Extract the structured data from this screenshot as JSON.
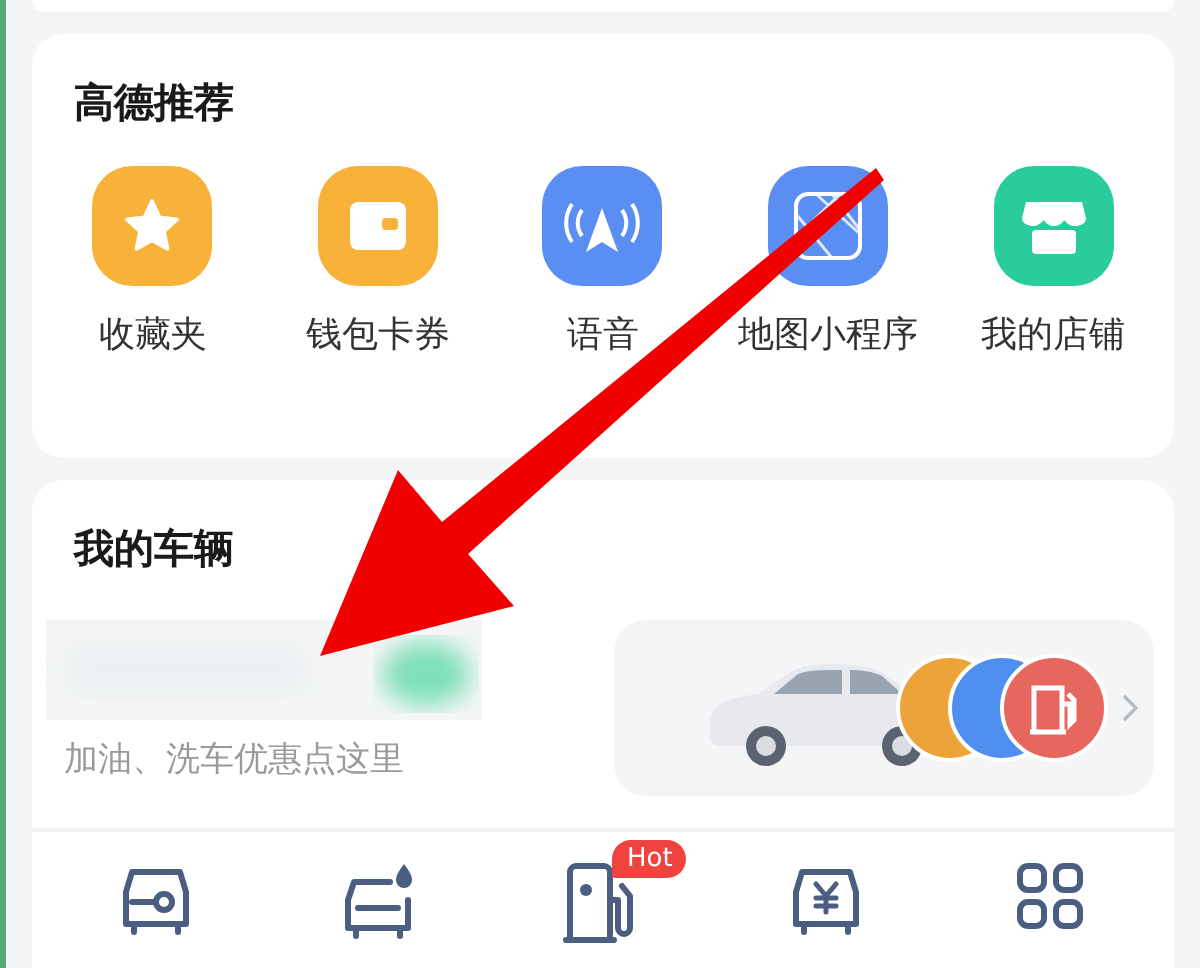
{
  "recommend": {
    "title": "高德推荐",
    "items": [
      {
        "kind": "star",
        "label": "收藏夹"
      },
      {
        "kind": "wallet",
        "label": "钱包卡券"
      },
      {
        "kind": "voice",
        "label": "语音"
      },
      {
        "kind": "map",
        "label": "地图小程序"
      },
      {
        "kind": "shop",
        "label": "我的店铺"
      }
    ]
  },
  "vehicle": {
    "title": "我的车辆",
    "subtitle": "加油、洗车优惠点这里"
  },
  "shortcuts": [
    {
      "kind": "car-key"
    },
    {
      "kind": "car-wash"
    },
    {
      "kind": "fuel",
      "badge": "Hot"
    },
    {
      "kind": "car-yen"
    },
    {
      "kind": "grid"
    }
  ]
}
